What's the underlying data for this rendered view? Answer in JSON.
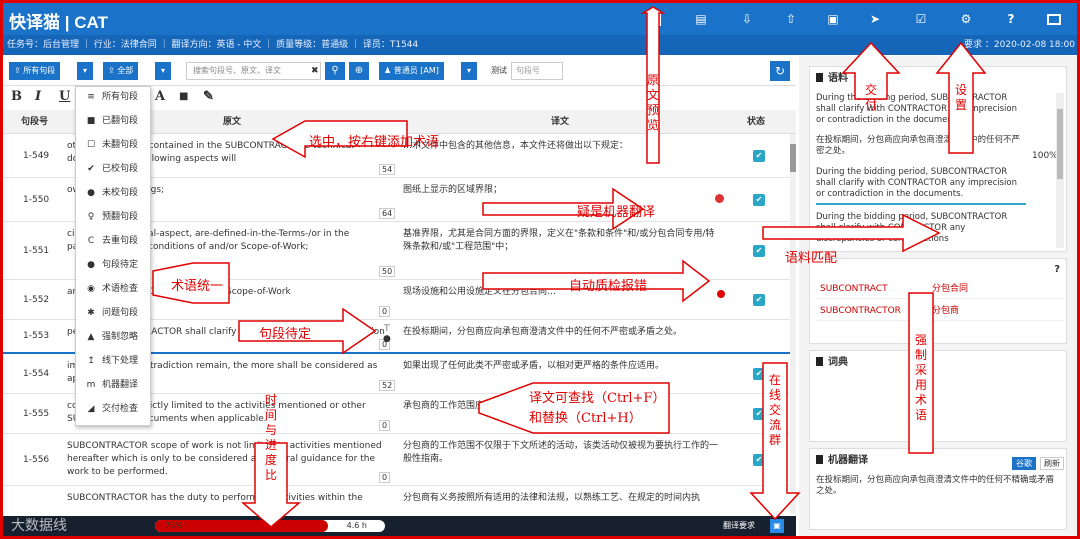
{
  "app": {
    "title": "快译猫 | CAT"
  },
  "task_bar": {
    "info": "任务号：后台管理 ｜ 行业：法律合同 ｜ 翻译方向：英语 - 中文 ｜ 质量等级：普通级 ｜ 译员：T1544",
    "date": "要求 ：2020-02-08 18:00"
  },
  "toolbar": {
    "all_segments": "所有句段",
    "all": "全部",
    "search_placeholder": "搜索句段号、原文、译文",
    "clear": "✖",
    "translator": "普通员 [AM]",
    "test_label": "测试",
    "seg_placeholder": "句段号"
  },
  "format": {
    "bold": "B",
    "italic": "I",
    "underline": "U",
    "font": "A",
    "grid": "■",
    "brush": "✎"
  },
  "grid": {
    "headers": {
      "id": "句段号",
      "source": "原文",
      "target": "译文",
      "status": "状态"
    },
    "rows": [
      {
        "id": "1-549",
        "src": "other information contained in the SUBCONTRACT the technical documents, the following aspects will",
        "num": "54",
        "tgt": "…术文件中包含的其他信息，本文件还将做出以下规定："
      },
      {
        "id": "1-550",
        "src": "own on the drawings;",
        "num": "64",
        "tgt": "图纸上显示的区域界限；"
      },
      {
        "id": "1-551",
        "src": "cially-of-contractual-aspect, are-defined-in-the-Terms-/or in the particular/special-conditions of and/or Scope-of-Work;",
        "num": "50",
        "tgt": "基准界限，尤其是合同方面的界限，定义在\"条款和条件\"和/或分包合同专用/特殊条款和/或\"工程范围\"中；"
      },
      {
        "id": "1-552",
        "src": "articular/special-CONTRACT-and/or Scope-of-Work",
        "num": "0",
        "tgt": "现场设施和公用设施定义在分包合同…"
      },
      {
        "id": "1-553",
        "src": "period, SUBCONTRACTOR shall clarify any imprecision or contradiction",
        "num": "0",
        "tgt": "在投标期间，分包商应向承包商澄清文件中的任何不严密或矛盾之处。"
      },
      {
        "id": "1-554",
        "src": "imprecision or contradiction remain, the more shall be considered as applicable.",
        "num": "52",
        "tgt": "如果出现了任何此类不严密或矛盾，以相对更严格的条件应适用。"
      },
      {
        "id": "1-555",
        "src": "cope of work is strictly limited to the activities mentioned or other SUBCONTRACT documents when applicable.",
        "num": "0",
        "tgt": "承包商的工作范围应严格限制于所述活动。"
      },
      {
        "id": "1-556",
        "src": "SUBCONTRACTOR scope of work is not limited to activities mentioned hereafter which is only to be considered as general guidance for the work to be performed.",
        "num": "0",
        "tgt": "分包商的工作范围不仅限于下文所述的活动，该类活动仅被视为要执行工作的一般性指南。"
      },
      {
        "id": "",
        "src": "SUBCONTRACTOR has the duty to perform all activities within the",
        "num": "",
        "tgt": "分包商有义务按照所有适用的法律和法规，以熟练工艺、在规定的时间内执"
      }
    ]
  },
  "menu": {
    "items": [
      {
        "icon": "≡",
        "label": "所有句段"
      },
      {
        "icon": "■",
        "label": "已翻句段"
      },
      {
        "icon": "☐",
        "label": "未翻句段"
      },
      {
        "icon": "✔",
        "label": "已校句段"
      },
      {
        "icon": "●",
        "label": "未校句段"
      },
      {
        "icon": "♀",
        "label": "预翻句段"
      },
      {
        "icon": "C",
        "label": "去重句段"
      },
      {
        "icon": "●",
        "label": "句段待定"
      },
      {
        "icon": "◉",
        "label": "术语检查"
      },
      {
        "icon": "✱",
        "label": "问题句段"
      },
      {
        "icon": "▲",
        "label": "强制忽略"
      },
      {
        "icon": "↥",
        "label": "线下处理"
      },
      {
        "icon": "m",
        "label": "机器翻译"
      },
      {
        "icon": "◢",
        "label": "交付检查"
      }
    ]
  },
  "status_bar": {
    "watermark": "大数据线",
    "progress_label": "75%",
    "progress_value": 0.75,
    "time": "4.6 h",
    "req_label": "翻译要求"
  },
  "right": {
    "tm_title": "语料",
    "tm": [
      "During the bidding period, SUBCONTRACTOR shall clarify with CONTRACTOR any imprecision or contradiction in the documents.",
      "在投标期间，分包商应向承包商澄清文件中的任何不严密之处。",
      "During the bidding period, SUBCONTRACTOR shall clarify with CONTRACTOR any imprecision or contradiction in the documents.",
      "During the bidding period, SUBCONTRACTOR shall clarify with CONTRACTOR any discrepancies or contradictions"
    ],
    "tm_pct": "100%",
    "term_help": "?",
    "terms": [
      {
        "en": "SUBCONTRACT",
        "zh": "分包合同"
      },
      {
        "en": "SUBCONTRACTOR",
        "zh": "分包商"
      }
    ],
    "dict_title": "词典",
    "mt_title": "机器翻译",
    "mt_btn1": "谷歌",
    "mt_btn2": "刷新",
    "mt_text": "在投标期间，分包商应向承包商澄清文件中的任何不精确或矛盾之处。"
  },
  "annotations": {
    "a1": "选中，按右键添加术语",
    "a2": "疑是机器翻译",
    "a3": "语料匹配",
    "a4": "自动质检报错",
    "a5": "术语统一",
    "a6": "句段待定",
    "a7": "译文可查找（Ctrl+F）和替换（Ctrl+H）",
    "v_preview": "原文预览",
    "v_deliver": "交付",
    "v_settings": "设置",
    "v_force": "强制采用术语",
    "v_chat": "在线交流群",
    "v_progress": "时间与进度比"
  },
  "colors": {
    "accent": "#1a73c8",
    "annotation": "#e00000",
    "check": "#2aa6c8"
  }
}
